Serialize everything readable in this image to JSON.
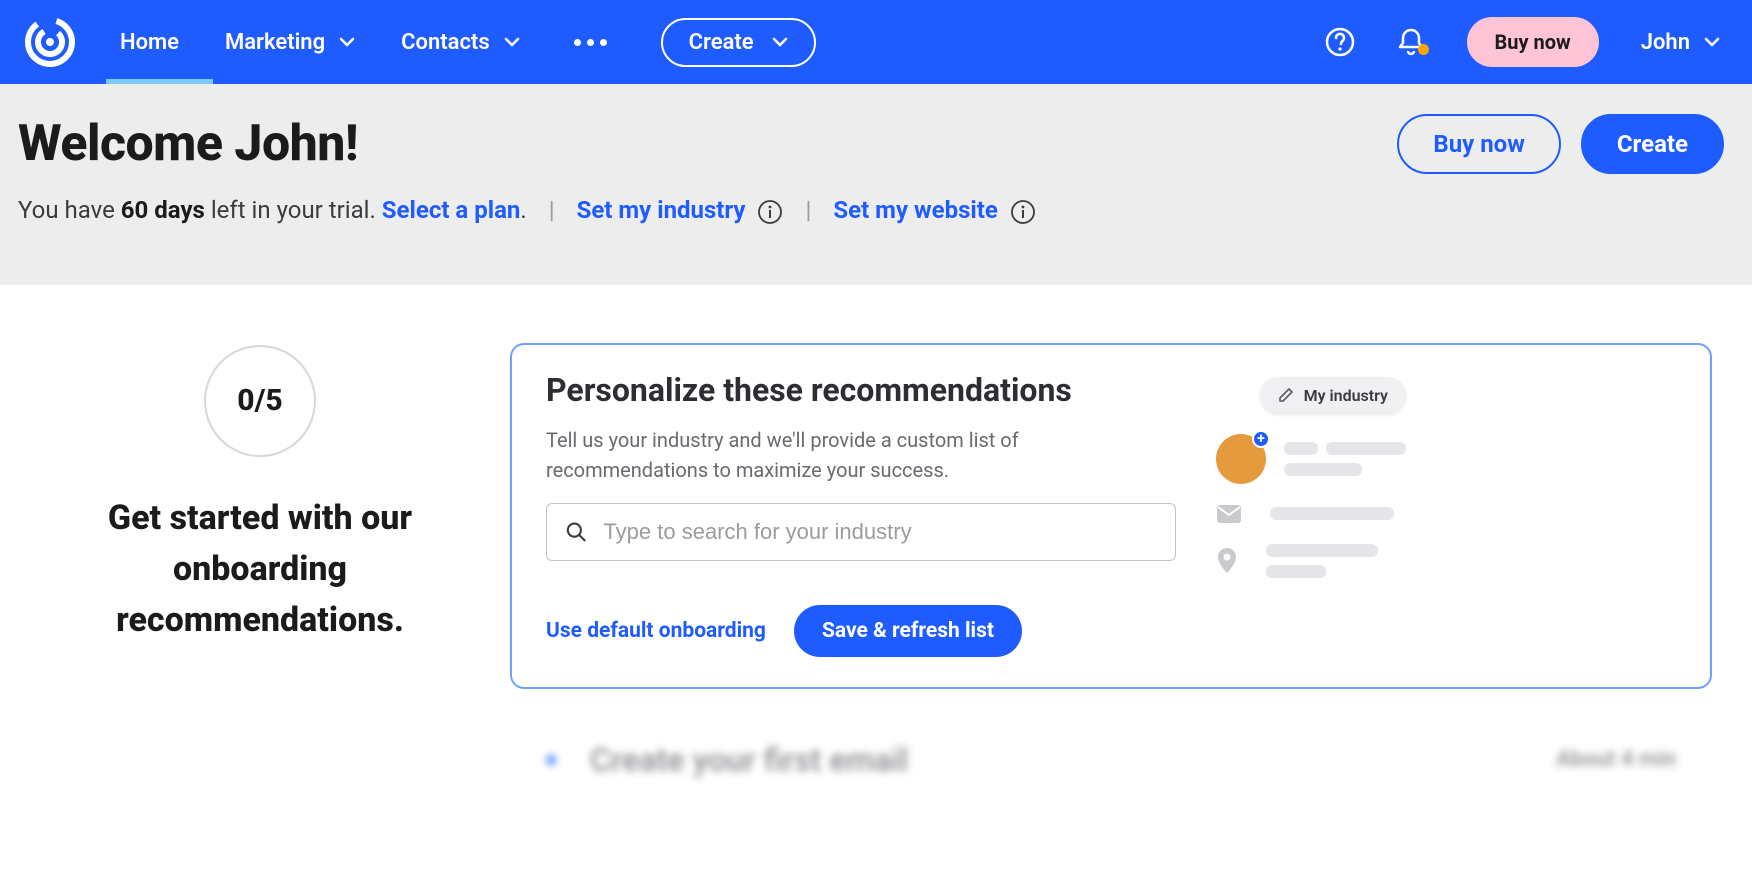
{
  "nav": {
    "home": "Home",
    "marketing": "Marketing",
    "contacts": "Contacts",
    "create": "Create",
    "buy_now": "Buy now",
    "user": "John"
  },
  "header": {
    "welcome": "Welcome John!",
    "buy_now": "Buy now",
    "create": "Create",
    "trial_prefix": "You have ",
    "trial_days": "60 days",
    "trial_suffix": " left in your trial. ",
    "select_plan": "Select a plan",
    "period": ".",
    "set_industry": "Set my industry",
    "set_website": "Set my website"
  },
  "sidebar": {
    "progress": "0/5",
    "title": "Get started with our onboarding recommendations."
  },
  "card": {
    "title": "Personalize these recommendations",
    "subtitle": "Tell us your industry and we'll provide a custom list of recommendations to maximize your success.",
    "search_placeholder": "Type to search for your industry",
    "default_link": "Use default onboarding",
    "save_btn": "Save & refresh list",
    "my_industry": "My industry"
  },
  "next_item": {
    "title": "Create your first email",
    "duration": "About 4 min"
  }
}
